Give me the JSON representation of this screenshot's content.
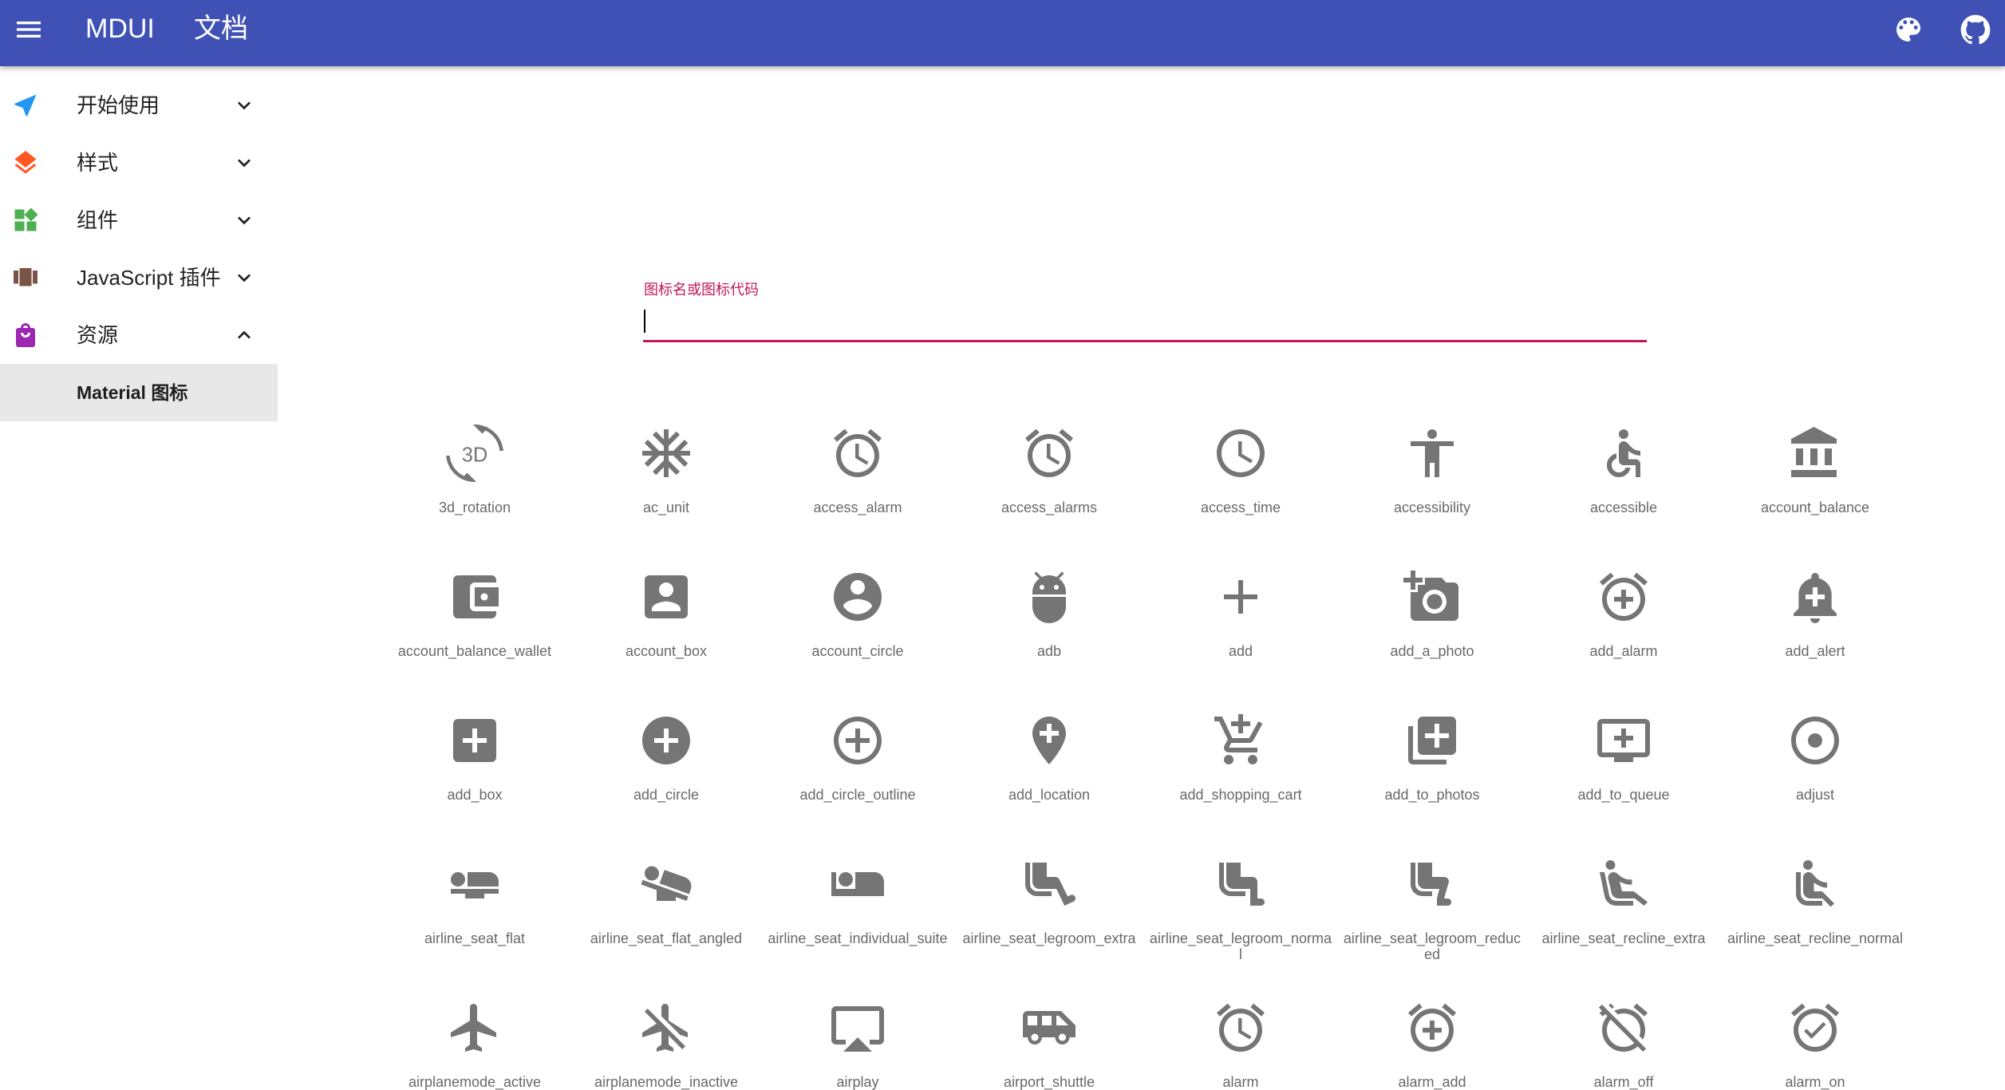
{
  "appbar": {
    "brand": "MDUI",
    "section": "文档",
    "bg_color": "#3f51b5"
  },
  "drawer": {
    "items": [
      {
        "label": "开始使用",
        "icon": "navigation-arrow-icon",
        "color": "#2196f3",
        "expanded": false
      },
      {
        "label": "样式",
        "icon": "layers-icon",
        "color": "#ff5722",
        "expanded": false
      },
      {
        "label": "组件",
        "icon": "widgets-icon",
        "color": "#4caf50",
        "expanded": false
      },
      {
        "label": "JavaScript 插件",
        "icon": "view-carousel-icon",
        "color": "#795548",
        "expanded": false
      },
      {
        "label": "资源",
        "icon": "shopping-bag-icon",
        "color": "#9c27b0",
        "expanded": true
      }
    ],
    "active_sub_item": "Material 图标"
  },
  "search": {
    "label": "图标名或图标代码",
    "value": "",
    "accent_color": "#c2185b"
  },
  "icons": [
    [
      "3d_rotation",
      "ac_unit",
      "access_alarm",
      "access_alarms",
      "access_time",
      "accessibility",
      "accessible",
      "account_balance"
    ],
    [
      "account_balance_wallet",
      "account_box",
      "account_circle",
      "adb",
      "add",
      "add_a_photo",
      "add_alarm",
      "add_alert"
    ],
    [
      "add_box",
      "add_circle",
      "add_circle_outline",
      "add_location",
      "add_shopping_cart",
      "add_to_photos",
      "add_to_queue",
      "adjust"
    ],
    [
      "airline_seat_flat",
      "airline_seat_flat_angled",
      "airline_seat_individual_suite",
      "airline_seat_legroom_extra",
      "airline_seat_legroom_normal",
      "airline_seat_legroom_reduced",
      "airline_seat_recline_extra",
      "airline_seat_recline_normal"
    ],
    [
      "airplanemode_active",
      "airplanemode_inactive",
      "airplay",
      "airport_shuttle",
      "alarm",
      "alarm_add",
      "alarm_off",
      "alarm_on"
    ]
  ],
  "icon_color": "#757575"
}
